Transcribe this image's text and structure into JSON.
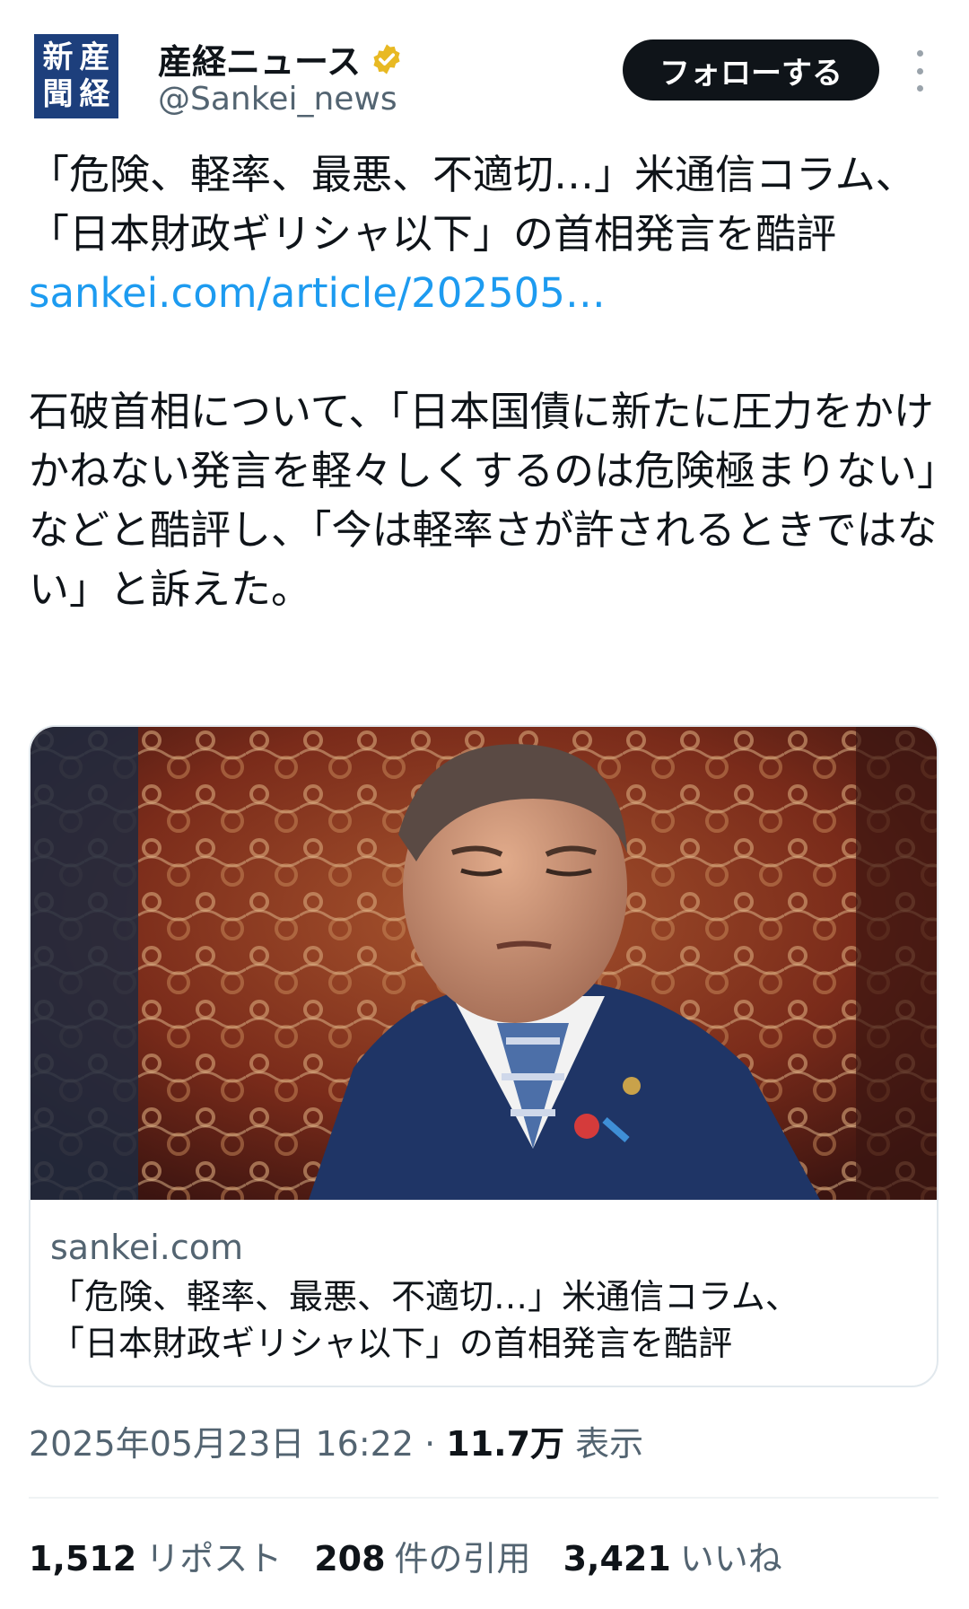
{
  "account": {
    "logo_chars": [
      "新",
      "産",
      "聞",
      "経"
    ],
    "name": "産経ニュース",
    "handle": "@Sankei_news",
    "follow_label": "フォローする"
  },
  "tweet": {
    "title": "「危険、軽率、最悪、不適切…」米通信コラム、「日本財政ギリシャ以下」の首相発言を酷評",
    "link": "sankei.com/article/202505…",
    "body": "石破首相について、「日本国債に新たに圧力をかけかねない発言を軽々しくするのは危険極まりない」などと酷評し、「今は軽率さが許されるときではない」と訴えた。"
  },
  "card": {
    "domain": "sankei.com",
    "title_line1": "「危険、軽率、最悪、不適切…」米通信コラム、",
    "title_line2": "「日本財政ギリシャ以下」の首相発言を酷評"
  },
  "meta": {
    "datetime": "2025年05月23日 16:22",
    "separator": "·",
    "views_count": "11.7万",
    "views_label": "表示"
  },
  "stats": {
    "reposts_count": "1,512",
    "reposts_label": "リポスト",
    "quotes_count": "208",
    "quotes_label": "件の引用",
    "likes_count": "3,421",
    "likes_label": "いいね"
  },
  "colors": {
    "link": "#1d9bf0",
    "verified": "#e8b923",
    "follow_bg": "#0f1419"
  }
}
